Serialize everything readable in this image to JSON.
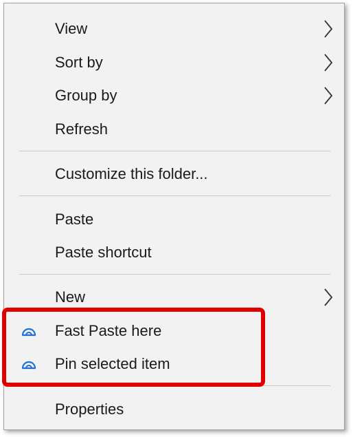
{
  "menu": {
    "items": [
      {
        "label": "View",
        "has_submenu": true
      },
      {
        "label": "Sort by",
        "has_submenu": true
      },
      {
        "label": "Group by",
        "has_submenu": true
      },
      {
        "label": "Refresh",
        "has_submenu": false
      },
      {
        "label": "Customize this folder...",
        "has_submenu": false
      },
      {
        "label": "Paste",
        "has_submenu": false
      },
      {
        "label": "Paste shortcut",
        "has_submenu": false
      },
      {
        "label": "New",
        "has_submenu": true
      },
      {
        "label": "Fast Paste here",
        "has_submenu": false,
        "icon": "cloud-arc-icon"
      },
      {
        "label": "Pin selected item",
        "has_submenu": false,
        "icon": "cloud-arc-icon"
      },
      {
        "label": "Properties",
        "has_submenu": false
      }
    ]
  },
  "colors": {
    "menu_background": "#f2f2f2",
    "highlight_border": "#e00000",
    "icon_blue": "#1e6fd9",
    "text": "#1a1a1a"
  }
}
